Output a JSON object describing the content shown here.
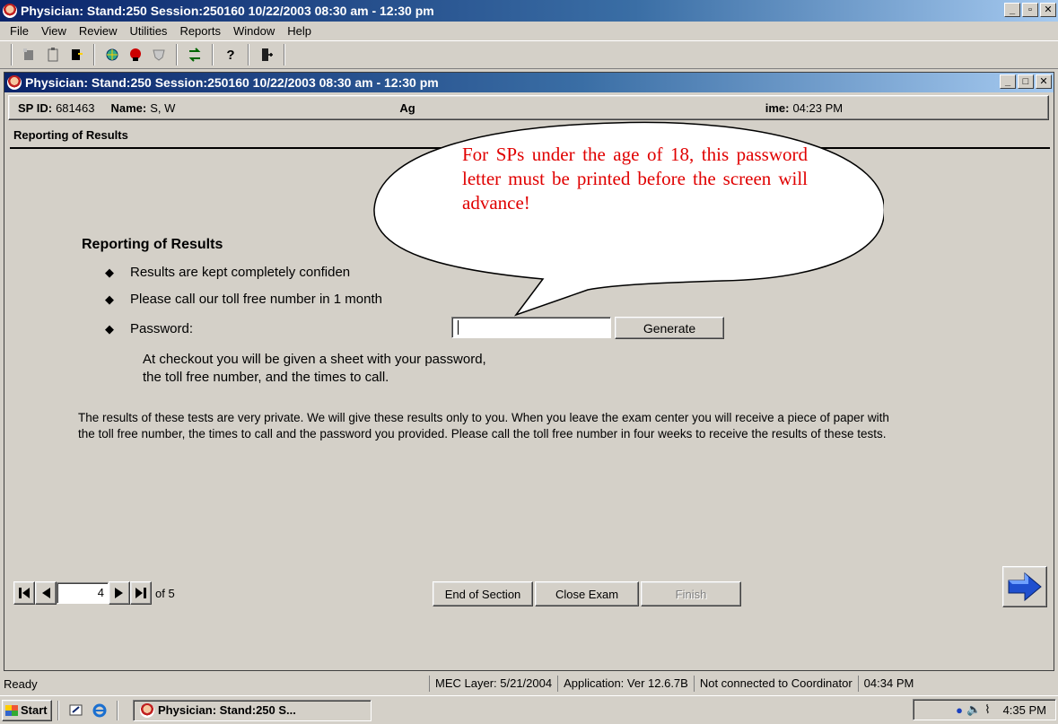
{
  "app": {
    "title": "Physician: Stand:250 Session:250160 10/22/2003 08:30 am - 12:30 pm"
  },
  "menu": {
    "items": [
      "File",
      "View",
      "Review",
      "Utilities",
      "Reports",
      "Window",
      "Help"
    ]
  },
  "child": {
    "title": "Physician: Stand:250 Session:250160 10/22/2003 08:30 am - 12:30 pm",
    "info": {
      "sp_id_label": "SP ID:",
      "sp_id_value": "681463",
      "name_label": "Name:",
      "name_value": "S, W",
      "age_label_partial": "Ag",
      "time_label_partial": "ime:",
      "time_value": "04:23 PM"
    },
    "section_title": "Reporting of Results"
  },
  "content": {
    "heading": "Reporting of Results",
    "bullets": [
      "Results are kept completely confiden",
      "Please call our toll free number in 1 month",
      "Password:"
    ],
    "password_value": "",
    "generate_label": "Generate",
    "checkout_line1": "At checkout you will be given a sheet with your password,",
    "checkout_line2": "the toll free number, and the times to call.",
    "privacy_text": "The results of these tests are very private.  We will give these results only to you. When you leave the exam center you will receive a piece of paper with the toll free number, the times to call and the password you provided. Please call the toll free number in four weeks to receive the results of these tests."
  },
  "callout": {
    "text": "For SPs under the age of 18, this password letter must be printed before the screen will advance!",
    "color": "#e00000"
  },
  "nav": {
    "page": "4",
    "of_label": "of 5",
    "end_section_label": "End of Section",
    "close_exam_label": "Close Exam",
    "finish_label": "Finish"
  },
  "status": {
    "ready": "Ready",
    "mec_layer": "MEC Layer: 5/21/2004",
    "application": "Application: Ver 12.6.7B",
    "coordinator": "Not connected to Coordinator",
    "time": "04:34 PM"
  },
  "taskbar": {
    "start_label": "Start",
    "task_label": "Physician: Stand:250 S...",
    "clock": "4:35 PM"
  },
  "colors": {
    "title_gradient_start": "#0a246a",
    "title_gradient_end": "#a6caf0",
    "face": "#d4d0c8"
  }
}
